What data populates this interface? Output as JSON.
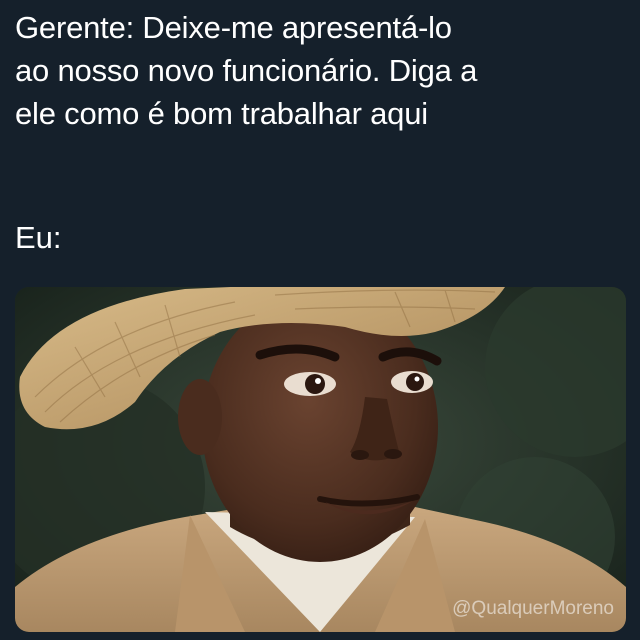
{
  "caption": {
    "lines": [
      "Gerente: Deixe-me apresentá-lo",
      "ao nosso novo funcionário. Diga a",
      "ele como é bom trabalhar aqui"
    ]
  },
  "me_label": "Eu:",
  "photo": {
    "watermark": "@QualquerMoreno"
  },
  "colors": {
    "background": "#15202b",
    "text": "#ffffff"
  }
}
